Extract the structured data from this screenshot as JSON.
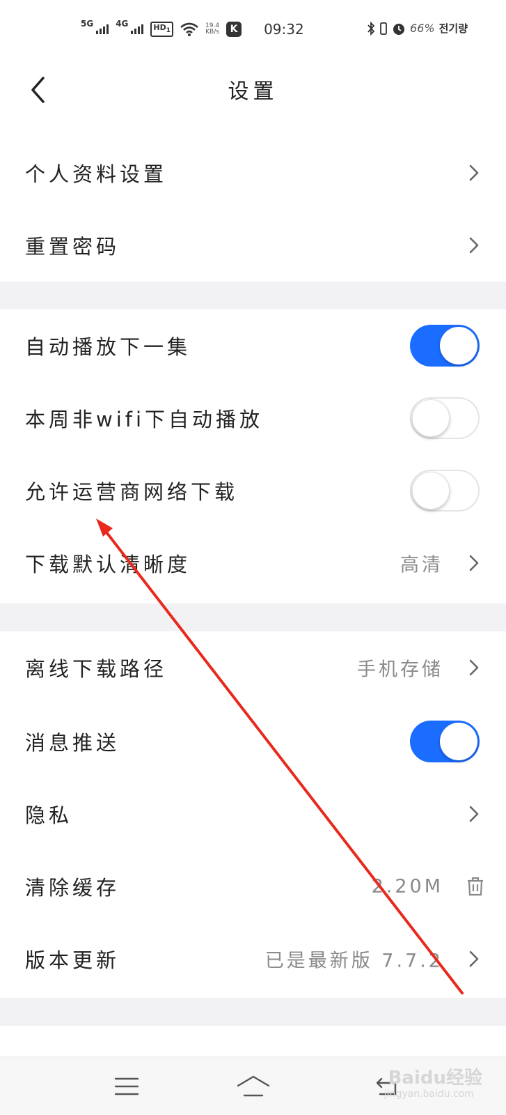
{
  "status_bar": {
    "net1": "5G",
    "net2": "4G",
    "hd": "HD",
    "hd_sub": "1",
    "speed_top": "19.4",
    "speed_bottom": "KB/s",
    "k_label": "K",
    "time": "09:32",
    "battery": "66%",
    "carrier": "전기량"
  },
  "header": {
    "title": "设置"
  },
  "rows": {
    "profile": {
      "label": "个人资料设置"
    },
    "reset_password": {
      "label": "重置密码"
    },
    "autoplay_next": {
      "label": "自动播放下一集",
      "on": true
    },
    "non_wifi_autoplay": {
      "label": "本周非wifi下自动播放",
      "on": false
    },
    "carrier_download": {
      "label": "允许运营商网络下载",
      "on": false
    },
    "download_quality": {
      "label": "下载默认清晰度",
      "value": "高清"
    },
    "offline_path": {
      "label": "离线下载路径",
      "value": "手机存储"
    },
    "push": {
      "label": "消息推送",
      "on": true
    },
    "privacy": {
      "label": "隐私"
    },
    "clear_cache": {
      "label": "清除缓存",
      "value": "2.20M"
    },
    "version": {
      "label": "版本更新",
      "value": "已是最新版 7.7.2"
    }
  },
  "watermark": {
    "text": "Baidu经验",
    "sub": "jingyan.baidu.com"
  },
  "colors": {
    "accent": "#1a6dff",
    "band": "#f2f2f4",
    "annotation": "#e8291c"
  },
  "icons": [
    "back-icon",
    "chevron-right-icon",
    "trash-icon",
    "menu-icon",
    "home-icon",
    "return-icon"
  ]
}
